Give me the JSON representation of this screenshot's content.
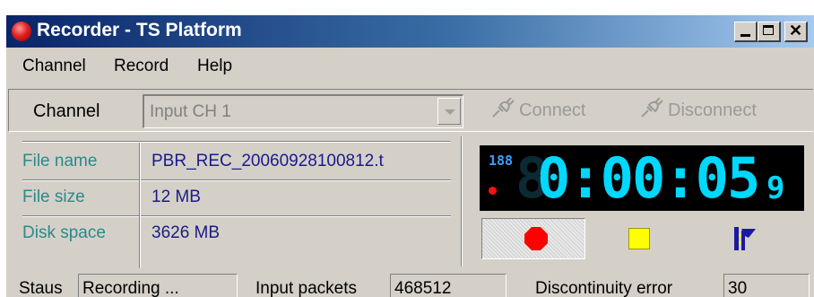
{
  "window": {
    "title": "Recorder - TS Platform",
    "controls": [
      "minimize",
      "maximize",
      "close"
    ]
  },
  "menu": [
    "Channel",
    "Record",
    "Help"
  ],
  "toolbar": {
    "channel_label": "Channel",
    "channel_value": "Input CH 1",
    "connect_label": "Connect",
    "disconnect_label": "Disconnect"
  },
  "info": {
    "file_name_label": "File name",
    "file_name_value": "PBR_REC_20060928100812.t",
    "file_size_label": "File size",
    "file_size_value": "12 MB",
    "disk_space_label": "Disk space",
    "disk_space_value": "3626 MB"
  },
  "timer": {
    "counter": "188",
    "time": "0:00:05",
    "tenths": "9"
  },
  "status": {
    "status_label": "Staus",
    "status_value": "Recording ...",
    "packets_label": "Input packets",
    "packets_value": "468512",
    "error_label": "Discontinuity error",
    "error_value": "30"
  },
  "colors": {
    "title_gradient_start": "#0a246a",
    "title_gradient_end": "#a6caf0",
    "window_bg": "#d4d0c8",
    "label_teal": "#2a8a8a",
    "value_navy": "#1a1a8a",
    "led_digits": "#00d8ff",
    "record_red": "#ff0000",
    "stop_yellow": "#ffff00"
  }
}
